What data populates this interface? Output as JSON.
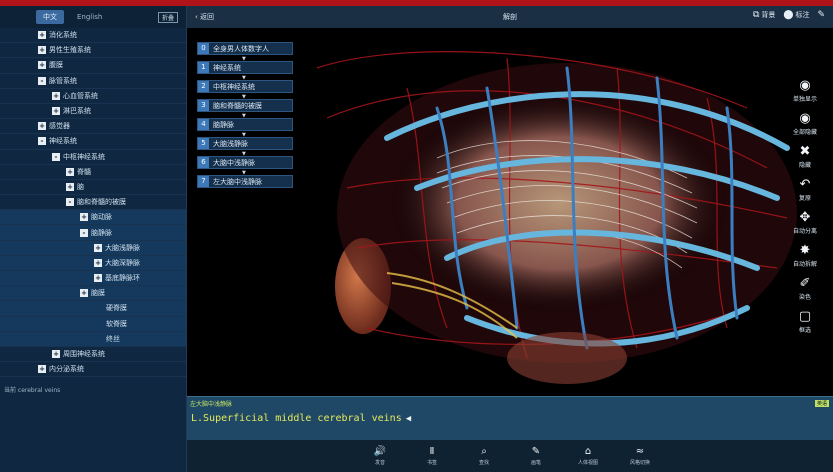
{
  "sidebar": {
    "lang_active": "中文",
    "lang_inactive": "English",
    "collapse_label": "折叠",
    "tree": [
      {
        "sign": "+",
        "label": "消化系统",
        "indent": 0
      },
      {
        "sign": "+",
        "label": "男性生殖系统",
        "indent": 0
      },
      {
        "sign": "+",
        "label": "腹膜",
        "indent": 0
      },
      {
        "sign": "-",
        "label": "脉管系统",
        "indent": 0
      },
      {
        "sign": "+",
        "label": "心血管系统",
        "indent": 1
      },
      {
        "sign": "+",
        "label": "淋巴系统",
        "indent": 1
      },
      {
        "sign": "+",
        "label": "感觉器",
        "indent": 0
      },
      {
        "sign": "-",
        "label": "神经系统",
        "indent": 0
      },
      {
        "sign": "-",
        "label": "中枢神经系统",
        "indent": 1
      },
      {
        "sign": "+",
        "label": "脊髓",
        "indent": 2
      },
      {
        "sign": "+",
        "label": "脑",
        "indent": 2
      },
      {
        "sign": "-",
        "label": "脑和脊髓的被膜",
        "indent": 2
      },
      {
        "sign": "+",
        "label": "脑动脉",
        "indent": 3
      },
      {
        "sign": "-",
        "label": "脑静脉",
        "indent": 3
      },
      {
        "sign": "+",
        "label": "大脑浅静脉",
        "indent": 4
      },
      {
        "sign": "+",
        "label": "大脑深静脉",
        "indent": 4
      },
      {
        "sign": "+",
        "label": "基底静脉环",
        "indent": 4
      },
      {
        "sign": "+",
        "label": "脑膜",
        "indent": 3
      },
      {
        "sign": "",
        "label": "硬脊膜",
        "indent": 4
      },
      {
        "sign": "",
        "label": "软脊膜",
        "indent": 4
      },
      {
        "sign": "",
        "label": "终丝",
        "indent": 4
      },
      {
        "sign": "+",
        "label": "周围神经系统",
        "indent": 1
      },
      {
        "sign": "+",
        "label": "内分泌系统",
        "indent": 0
      }
    ],
    "search_text": "当前 cerebral veins"
  },
  "topbar": {
    "back_label": "返回",
    "title": "解剖",
    "actions": [
      {
        "icon": "⧉",
        "label": "背景"
      },
      {
        "icon": "⬤",
        "label": "标注"
      },
      {
        "icon": "✎",
        "label": ""
      }
    ]
  },
  "path": [
    {
      "num": "0",
      "label": "全身男人体数字人"
    },
    {
      "num": "1",
      "label": "神经系统"
    },
    {
      "num": "2",
      "label": "中枢神经系统"
    },
    {
      "num": "3",
      "label": "脑和脊髓的被膜"
    },
    {
      "num": "4",
      "label": "脑静脉"
    },
    {
      "num": "5",
      "label": "大脑浅静脉"
    },
    {
      "num": "6",
      "label": "大脑中浅静脉"
    },
    {
      "num": "7",
      "label": "左大脑中浅静脉"
    }
  ],
  "tools": [
    {
      "icon": "◉",
      "label": "单独显示"
    },
    {
      "icon": "◉",
      "label": "全部隐藏"
    },
    {
      "icon": "✖",
      "label": "隐藏"
    },
    {
      "icon": "↶",
      "label": "复原"
    },
    {
      "icon": "✥",
      "label": "自动分离"
    },
    {
      "icon": "✸",
      "label": "自动拆解"
    },
    {
      "icon": "✐",
      "label": "染色"
    },
    {
      "icon": "▢",
      "label": "框选"
    }
  ],
  "info": {
    "title": "左大脑中浅静脉",
    "badge": "英语",
    "text": "L.Superficial middle cerebral veins"
  },
  "bottom_tools": [
    {
      "icon": "🔊",
      "label": "发音"
    },
    {
      "icon": "Ⅱ",
      "label": "书签"
    },
    {
      "icon": "⌕",
      "label": "查找"
    },
    {
      "icon": "✎",
      "label": "画笔"
    },
    {
      "icon": "⌂",
      "label": "人体视图"
    },
    {
      "icon": "≈",
      "label": "风格切换"
    }
  ]
}
